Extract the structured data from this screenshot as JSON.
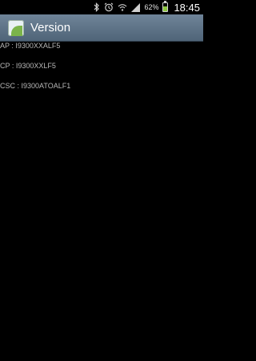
{
  "status_bar": {
    "battery_percent": "62%",
    "battery_level": 0.62,
    "time": "18:45",
    "icons": [
      "bluetooth-icon",
      "alarm-icon",
      "wifi-icon",
      "signal-icon",
      "battery-icon"
    ]
  },
  "action_bar": {
    "title": "Version",
    "icon": "app-icon"
  },
  "versions": [
    {
      "text": "AP : I9300XXALF5"
    },
    {
      "text": "CP : I9300XXLF5"
    },
    {
      "text": "CSC : I9300ATOALF1"
    }
  ],
  "colors": {
    "background": "#000000",
    "action_bar": "#5b7085",
    "text": "#b8b8b8",
    "battery": "#8cc63f"
  }
}
